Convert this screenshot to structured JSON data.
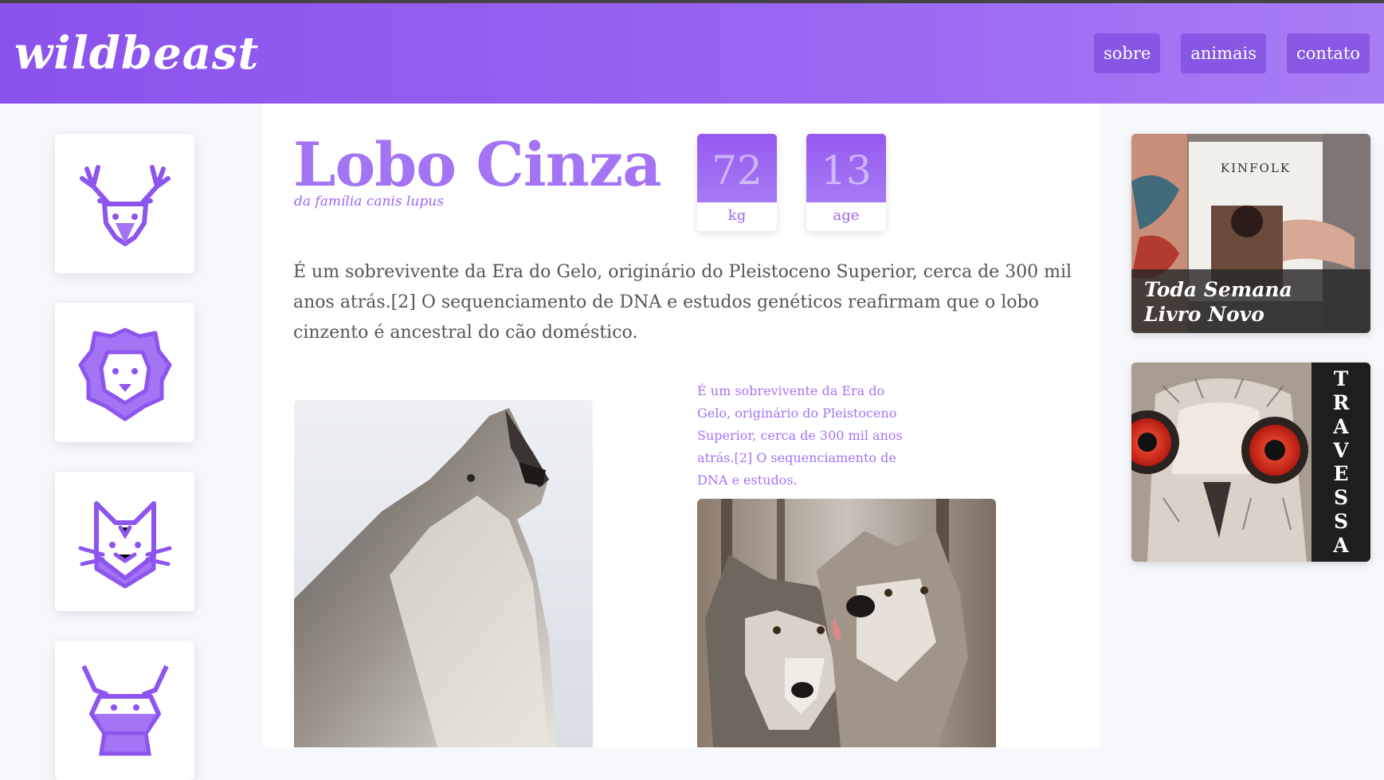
{
  "header": {
    "logo": "wildbeast",
    "nav": [
      "sobre",
      "animais",
      "contato"
    ]
  },
  "sidebar": {
    "icons": [
      "deer-icon",
      "lion-icon",
      "cat-icon",
      "bull-icon"
    ]
  },
  "main": {
    "title": "Lobo Cinza",
    "subtitle": "da família canis lupus",
    "stats": [
      {
        "value": "72",
        "unit": "kg"
      },
      {
        "value": "13",
        "unit": "age"
      }
    ],
    "paragraph": "É um sobrevivente da Era do Gelo, originário do Pleistoceno Superior, cerca de 300 mil anos atrás.[2] O sequenciamento de DNA e estudos genéticos reafirmam que o lobo cinzento é ancestral do cão doméstico.",
    "quote": "É um sobrevivente da Era do Gelo, originário do Pleistoceno Superior, cerca de 300 mil anos atrás.[2] O sequenciamento de DNA e estudos."
  },
  "promos": {
    "kinfolk_label": "KINFOLK",
    "caption_line1": "Toda Semana",
    "caption_line2": "Livro Novo",
    "travessa": [
      "T",
      "R",
      "A",
      "V",
      "E",
      "S",
      "S",
      "A"
    ]
  },
  "colors": {
    "accent": "#9a66f2",
    "accent_dark": "#8a52ec"
  }
}
